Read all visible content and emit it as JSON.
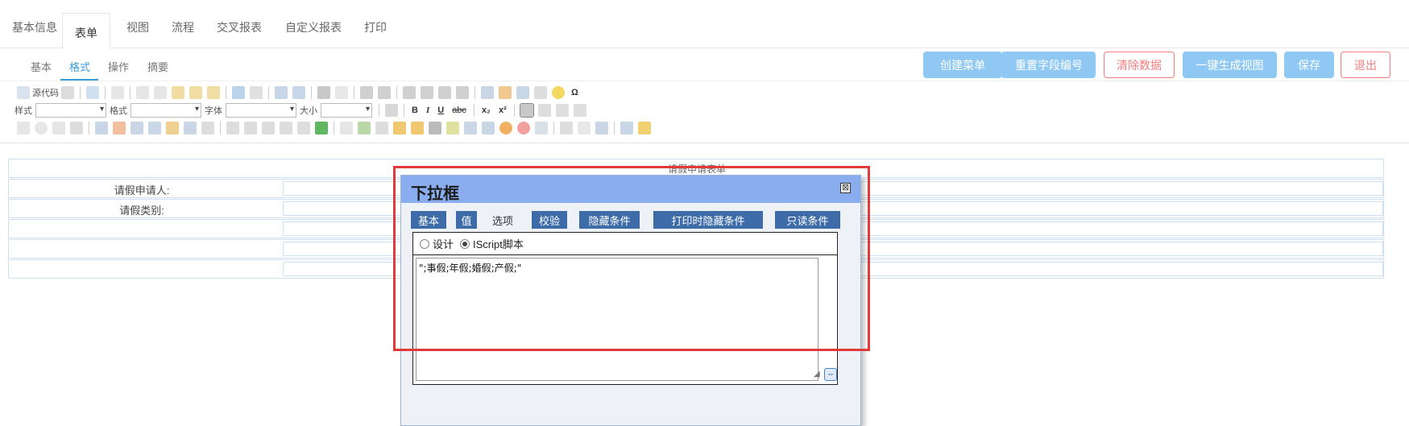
{
  "main_tabs": [
    {
      "label": "基本信息"
    },
    {
      "label": "表单"
    },
    {
      "label": "视图"
    },
    {
      "label": "流程"
    },
    {
      "label": "交叉报表"
    },
    {
      "label": "自定义报表"
    },
    {
      "label": "打印"
    }
  ],
  "sub_tabs": [
    {
      "label": "基本"
    },
    {
      "label": "格式"
    },
    {
      "label": "操作"
    },
    {
      "label": "摘要"
    }
  ],
  "actions": {
    "create_menu": "创建菜单",
    "reset_field_no": "重置字段编号",
    "clear_data": "清除数据",
    "generate_view": "一键生成视图",
    "save": "保存",
    "exit": "退出"
  },
  "toolbar": {
    "source_code": "源代码",
    "style_label": "样式",
    "format_label": "格式",
    "font_label": "字体",
    "size_label": "大小",
    "bold": "B",
    "italic": "I",
    "underline": "U",
    "strike": "abc",
    "subscript": "x₂",
    "superscript": "x²",
    "omega": "Ω"
  },
  "form": {
    "title": "请假申请表单",
    "applicant_label": "请假申请人:",
    "leave_type_label": "请假类别:"
  },
  "dialog": {
    "title": "下拉框",
    "close": "⊠",
    "tabs": [
      "基本",
      "值",
      "选项",
      "校验",
      "隐藏条件",
      "打印时隐藏条件",
      "只读条件"
    ],
    "radio_design": "设计",
    "radio_script": "IScript脚本",
    "script_value": "\";事假;年假;婚假;产假;\""
  },
  "colors": {
    "primary_button": "#8fc9f3",
    "danger_outline": "#f27d7d",
    "dialog_header": "#8aadf0",
    "dialog_tab": "#3d6ca8",
    "highlight": "#e03a3a",
    "active_subtab": "#3a9bd8"
  }
}
